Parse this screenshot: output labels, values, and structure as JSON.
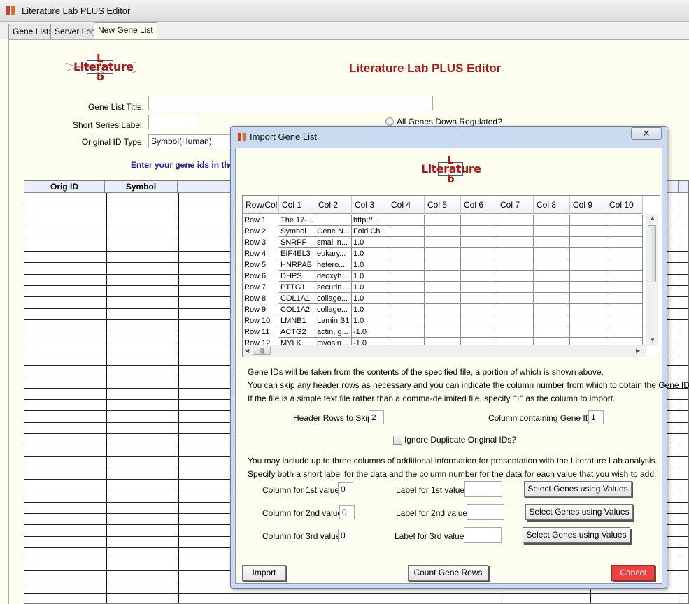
{
  "window": {
    "title": "Literature Lab PLUS Editor"
  },
  "tabs": [
    {
      "label": "Gene Lists"
    },
    {
      "label": "Server Log"
    },
    {
      "label": "New Gene List",
      "active": true
    }
  ],
  "logo": {
    "word": "Literature",
    "top_letter": "L",
    "bottom_letter": "b"
  },
  "editor": {
    "heading": "Literature Lab PLUS Editor",
    "gene_list_title_label": "Gene List Title:",
    "gene_list_title_value": "",
    "short_series_label": "Short Series Label:",
    "short_series_value": "",
    "original_id_type_label": "Original ID Type:",
    "original_id_type_value": "Symbol(Human)",
    "all_genes_down_label": "All Genes Down Regulated?",
    "instruction": "Enter your gene ids in the",
    "grid_headers": [
      "Orig ID",
      "Symbol"
    ]
  },
  "dialog": {
    "title": "Import Gene List",
    "close_glyph": "✕",
    "preview": {
      "headers": [
        "Row/Col",
        "Col 1",
        "Col 2",
        "Col 3",
        "Col 4",
        "Col 5",
        "Col 6",
        "Col 7",
        "Col 8",
        "Col 9",
        "Col 10"
      ],
      "rows": [
        {
          "label": "Row 1",
          "cells": [
            "The 17-...",
            "",
            "http://..."
          ]
        },
        {
          "label": "Row 2",
          "cells": [
            "Symbol",
            "Gene N...",
            "Fold Ch..."
          ]
        },
        {
          "label": "Row 3",
          "cells": [
            "SNRPF",
            "small n...",
            "1.0"
          ]
        },
        {
          "label": "Row 4",
          "cells": [
            "EIF4EL3",
            "eukary...",
            "1.0"
          ]
        },
        {
          "label": "Row 5",
          "cells": [
            "HNRPAB",
            "hetero...",
            "1.0"
          ]
        },
        {
          "label": "Row 6",
          "cells": [
            "DHPS",
            "deoxyh...",
            "1.0"
          ]
        },
        {
          "label": "Row 7",
          "cells": [
            "PTTG1",
            "securin ...",
            "1.0"
          ]
        },
        {
          "label": "Row 8",
          "cells": [
            "COL1A1",
            "collage...",
            "1.0"
          ]
        },
        {
          "label": "Row 9",
          "cells": [
            "COL1A2",
            "collage...",
            "1.0"
          ]
        },
        {
          "label": "Row 10",
          "cells": [
            "LMNB1",
            "Lamin B1",
            "1.0"
          ]
        },
        {
          "label": "Row 11",
          "cells": [
            "ACTG2",
            "actin, g...",
            "-1.0"
          ]
        },
        {
          "label": "Row 12",
          "cells": [
            "MYLK",
            "myosin ...",
            "-1.0"
          ]
        }
      ]
    },
    "desc_line_1": "Gene IDs will be taken from the contents of the specified file, a portion of which is shown above.",
    "desc_line_2": "You can skip any header rows as necessary and you can indicate the column number from which to obtain the Gene IDs.",
    "desc_line_3": "If the file is a simple text file rather than a comma-delimited file, specify \"1\" as the column to import.",
    "header_rows_label": "Header Rows to Skip:",
    "header_rows_value": "2",
    "gene_id_col_label": "Column containing Gene IDs:",
    "gene_id_col_value": "1",
    "ignore_dup_label": "Ignore Duplicate Original IDs?",
    "extra_line_1": "You may include up to three columns of additional information for presentation with the Literature Lab analysis.",
    "extra_line_2": "Specify both a short label for the data and the column number for the data for each value that you wish to add:",
    "values": [
      {
        "col_label": "Column for 1st value:",
        "col_value": "0",
        "label_label": "Label for 1st value:",
        "label_value": "",
        "button": "Select Genes using Values"
      },
      {
        "col_label": "Column for 2nd value:",
        "col_value": "0",
        "label_label": "Label for 2nd value:",
        "label_value": "",
        "button": "Select Genes using Values"
      },
      {
        "col_label": "Column for 3rd value:",
        "col_value": "0",
        "label_label": "Label for 3rd value:",
        "label_value": "",
        "button": "Select Genes using Values"
      }
    ],
    "import_button": "Import",
    "count_button": "Count Gene Rows",
    "cancel_button": "Cancel"
  }
}
